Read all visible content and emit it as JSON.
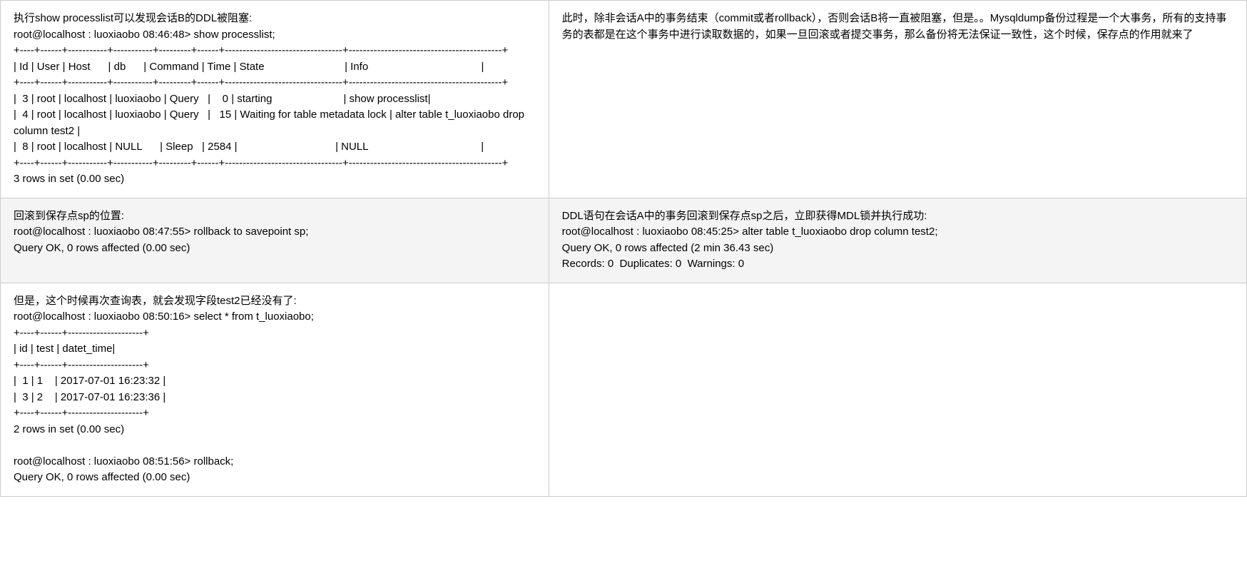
{
  "row1": {
    "left": "执行show processlist可以发现会话B的DDL被阻塞:\nroot@localhost : luoxiaobo 08:46:48> show processlist;\n+----+------+-----------+-----------+---------+------+---------------------------------+-------------------------------------------+\n| Id | User | Host      | db      | Command | Time | State                           | Info                                      |\n+----+------+-----------+-----------+---------+------+---------------------------------+-------------------------------------------+\n|  3 | root | localhost | luoxiaobo | Query   |    0 | starting                        | show processlist|\n|  4 | root | localhost | luoxiaobo | Query   |   15 | Waiting for table metadata lock | alter table t_luoxiaobo drop column test2 |\n|  8 | root | localhost | NULL      | Sleep   | 2584 |                                 | NULL                                      |\n+----+------+-----------+-----------+---------+------+---------------------------------+-------------------------------------------+\n3 rows in set (0.00 sec)",
    "right": "此时，除非会话A中的事务结束（commit或者rollback），否则会话B将一直被阻塞，但是。。Mysqldump备份过程是一个大事务，所有的支持事务的表都是在这个事务中进行读取数据的，如果一旦回滚或者提交事务，那么备份将无法保证一致性，这个时候，保存点的作用就来了"
  },
  "row2": {
    "left": "回滚到保存点sp的位置:\nroot@localhost : luoxiaobo 08:47:55> rollback to savepoint sp;\nQuery OK, 0 rows affected (0.00 sec)",
    "right": "DDL语句在会话A中的事务回滚到保存点sp之后，立即获得MDL锁并执行成功:\nroot@localhost : luoxiaobo 08:45:25> alter table t_luoxiaobo drop column test2;\nQuery OK, 0 rows affected (2 min 36.43 sec)\nRecords: 0  Duplicates: 0  Warnings: 0"
  },
  "row3": {
    "left": "但是，这个时候再次查询表，就会发现字段test2已经没有了:\nroot@localhost : luoxiaobo 08:50:16> select * from t_luoxiaobo;\n+----+------+---------------------+\n| id | test | datet_time|\n+----+------+---------------------+\n|  1 | 1    | 2017-07-01 16:23:32 |\n|  3 | 2    | 2017-07-01 16:23:36 |\n+----+------+---------------------+\n2 rows in set (0.00 sec)\n\nroot@localhost : luoxiaobo 08:51:56> rollback;\nQuery OK, 0 rows affected (0.00 sec)",
    "right": ""
  }
}
